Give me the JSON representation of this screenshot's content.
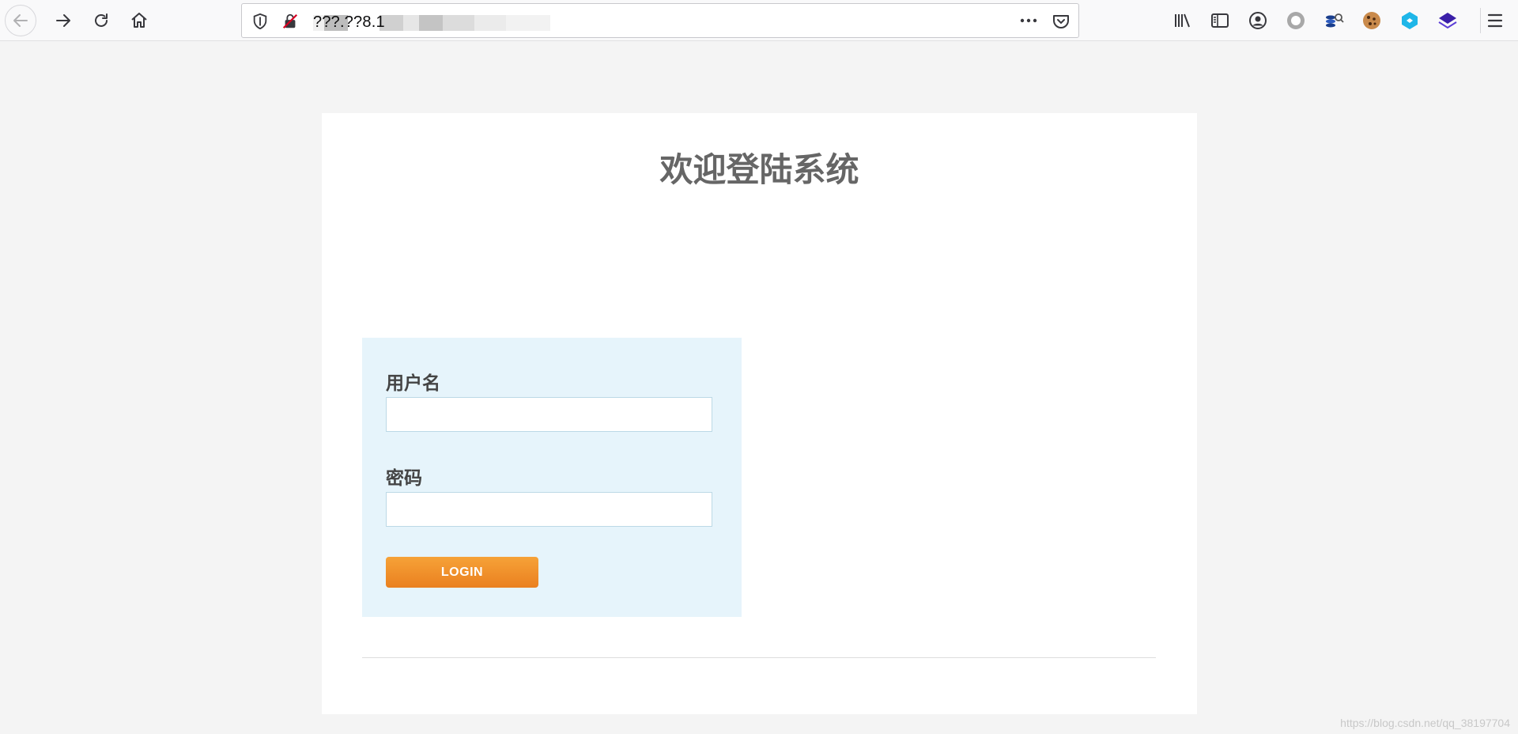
{
  "browser": {
    "url": "???.??8.1",
    "icons": {
      "back": "back-arrow-icon",
      "forward": "forward-arrow-icon",
      "reload": "reload-icon",
      "home": "home-icon",
      "tracking": "tracking-shield-icon",
      "insecure": "insecure-connection-icon",
      "page_actions": "more-dots-icon",
      "pocket": "pocket-icon",
      "library": "library-icon",
      "sidebar": "sidebar-icon",
      "account": "account-icon",
      "ext1": "record-circle-icon",
      "ext2": "coin-stack-icon",
      "ext3": "cookie-icon",
      "ext4": "cube-icon",
      "ext5": "layers-icon",
      "menu": "hamburger-menu-icon"
    }
  },
  "page": {
    "title": "欢迎登陆系统",
    "form": {
      "username_label": "用户名",
      "username_value": "",
      "password_label": "密码",
      "password_value": "",
      "login_label": "LOGIN"
    },
    "colors": {
      "panel_bg": "#e6f4fb",
      "button": "#f0902a",
      "title": "#666666"
    }
  },
  "watermark": "https://blog.csdn.net/qq_38197704"
}
